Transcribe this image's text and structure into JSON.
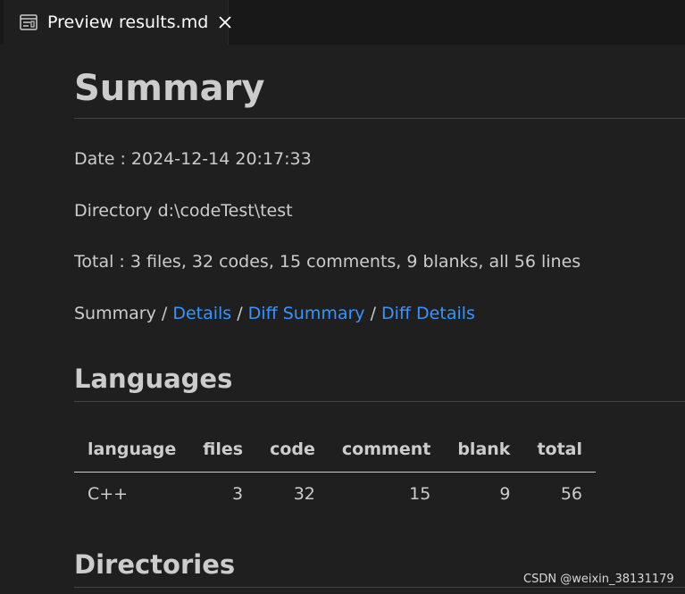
{
  "tab": {
    "title": "Preview results.md",
    "icon": "preview-icon",
    "close_icon": "close-icon"
  },
  "doc": {
    "title": "Summary",
    "date": "Date : 2024-12-14 20:17:33",
    "directory": "Directory d:\\codeTest\\test",
    "total": "Total : 3 files, 32 codes, 15 comments, 9 blanks, all 56 lines",
    "nav": {
      "current": "Summary",
      "sep": " / ",
      "links": [
        "Details",
        "Diff Summary",
        "Diff Details"
      ]
    },
    "languages_heading": "Languages",
    "table": {
      "headers": [
        "language",
        "files",
        "code",
        "comment",
        "blank",
        "total"
      ],
      "rows": [
        [
          "C++",
          "3",
          "32",
          "15",
          "9",
          "56"
        ]
      ]
    },
    "directories_heading": "Directories"
  },
  "watermark": "CSDN @weixin_38131179",
  "colors": {
    "background": "#1f1f1f",
    "link": "#3794ff",
    "text": "#cccccc"
  }
}
